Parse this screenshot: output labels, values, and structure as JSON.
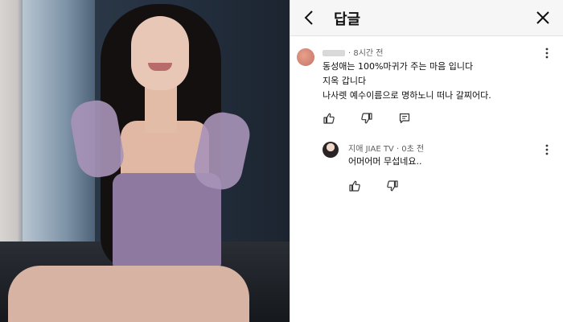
{
  "header": {
    "title": "답글"
  },
  "comment": {
    "time": "· 8시간 전",
    "lines": [
      "동성애는 100%마귀가 주는 마음  입니다",
      "지옥 갑니다",
      "나사렛 예수이름으로 명하노니 떠나 갈찌어다."
    ]
  },
  "reply": {
    "author": "지애 JIAE TV",
    "time": "· 0초 전",
    "text": "어머어머 무섭네요.."
  },
  "icons": {
    "back": "chevron-left-icon",
    "close": "close-icon",
    "like": "thumbs-up-icon",
    "dislike": "thumbs-down-icon",
    "reply": "reply-icon",
    "more": "more-vert-icon"
  }
}
